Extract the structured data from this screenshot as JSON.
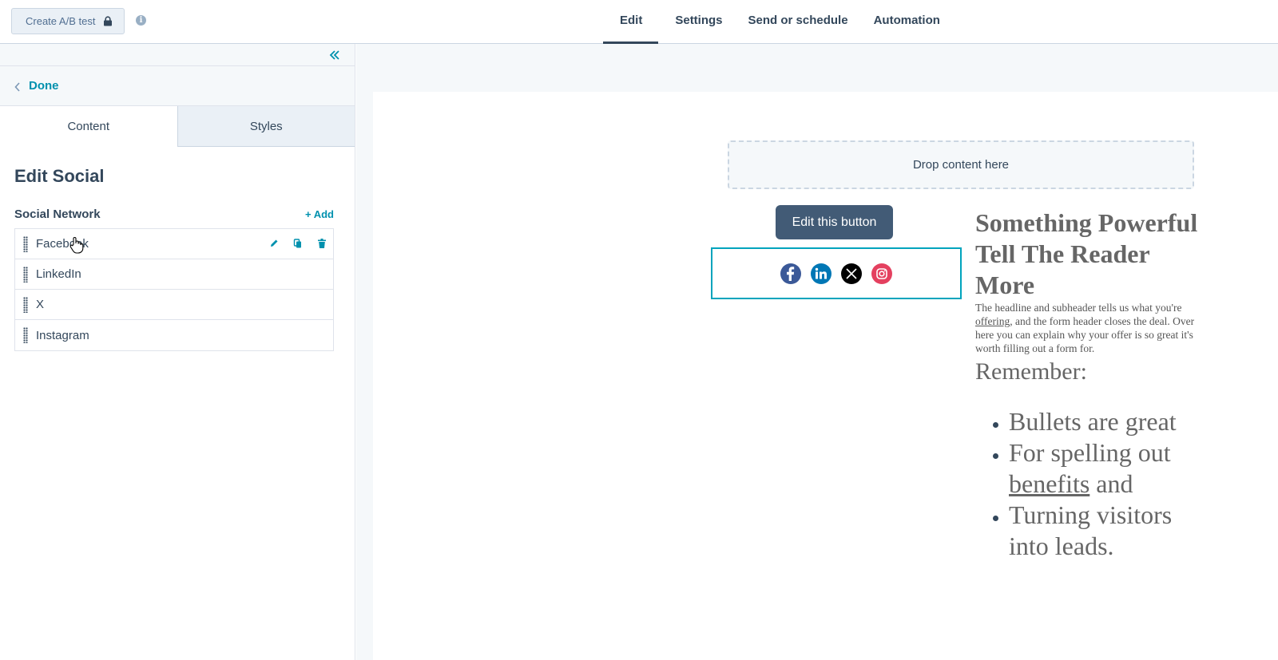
{
  "toolbar": {
    "ab_test_label": "Create A/B test",
    "tabs": [
      {
        "label": "Edit"
      },
      {
        "label": "Settings"
      },
      {
        "label": "Send or schedule"
      },
      {
        "label": "Automation"
      }
    ]
  },
  "panel": {
    "done_label": "Done",
    "tabs": {
      "content": "Content",
      "styles": "Styles"
    },
    "title": "Edit Social",
    "section_label": "Social Network",
    "add_label": "+ Add",
    "networks": [
      {
        "name": "Facebook"
      },
      {
        "name": "LinkedIn"
      },
      {
        "name": "X"
      },
      {
        "name": "Instagram"
      }
    ]
  },
  "canvas": {
    "dropzone_label": "Drop content here",
    "button_label": "Edit this button",
    "social_icons": [
      "facebook-icon",
      "linkedin-icon",
      "x-icon",
      "instagram-icon"
    ],
    "headline_1": "Something Powerful",
    "headline_2": "Tell The Reader More",
    "body_pre": "The headline and subheader tells us what you're ",
    "body_link": "offering",
    "body_post": ", and the form header closes the deal. Over here you can explain why your offer is so great it's worth filling out a form for.",
    "remember": "Remember:",
    "bullet_1": "Bullets are great",
    "bullet_2_pre": "For spelling out ",
    "bullet_2_link": "benefits",
    "bullet_2_post": " and",
    "bullet_3": "Turning visitors into leads."
  },
  "colors": {
    "accent": "#0091ae",
    "button_bg": "#425b76",
    "selected_border": "#00a4bd",
    "facebook": "#3b5998",
    "linkedin": "#0077b5",
    "x": "#000000",
    "instagram": "#e4405f"
  }
}
